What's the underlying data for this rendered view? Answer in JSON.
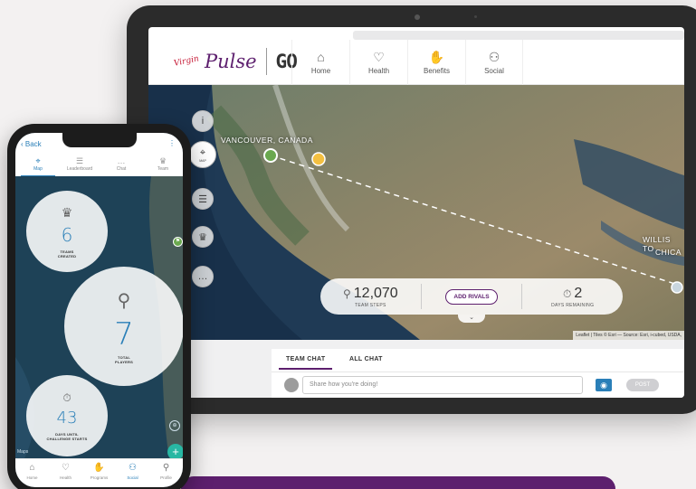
{
  "tablet": {
    "brand": {
      "virgin": "Virgin",
      "pulse": "Pulse",
      "go": "GO"
    },
    "nav": [
      {
        "label": "Home",
        "icon": "home-icon",
        "glyph": "⌂"
      },
      {
        "label": "Health",
        "icon": "heart-icon",
        "glyph": "♡"
      },
      {
        "label": "Benefits",
        "icon": "handshake-icon",
        "glyph": "✋"
      },
      {
        "label": "Social",
        "icon": "people-icon",
        "glyph": "⚇"
      }
    ],
    "map": {
      "cities": {
        "origin": "VANCOUVER, CANADA",
        "dest_line1": "WILLIS TO",
        "dest_line2": "CHICA"
      },
      "side_buttons": [
        {
          "icon": "info-icon",
          "glyph": "i"
        },
        {
          "icon": "location-icon",
          "glyph": "⌖",
          "caption": "MAP"
        },
        {
          "icon": "list-icon",
          "glyph": "☰"
        },
        {
          "icon": "trophy-icon",
          "glyph": "♛"
        },
        {
          "icon": "chat-icon",
          "glyph": "…"
        }
      ],
      "stats": {
        "team_steps_value": "12,070",
        "team_steps_label": "TEAM STEPS",
        "add_rivals": "ADD RIVALS",
        "days_value": "2",
        "days_label": "DAYS REMAINING"
      },
      "attribution": "Leaflet | Tiles © Esri — Source: Esri, i-cubed, USDA,"
    },
    "chat": {
      "tabs": [
        "TEAM CHAT",
        "ALL CHAT"
      ],
      "placeholder": "Share how you're doing!",
      "send": "POST"
    }
  },
  "phone": {
    "back": "Back",
    "tabs": [
      {
        "label": "Map",
        "glyph": "⌖"
      },
      {
        "label": "Leaderboard",
        "glyph": "☰"
      },
      {
        "label": "Chat",
        "glyph": "…"
      },
      {
        "label": "Team",
        "glyph": "♛"
      }
    ],
    "bubbles": {
      "teams": {
        "value": "6",
        "label_line1": "TEAMS",
        "label_line2": "CREATED"
      },
      "players": {
        "value": "7",
        "label_line1": "TOTAL",
        "label_line2": "PLAYERS"
      },
      "days": {
        "value": "43",
        "label_line1": "DAYS UNTIL",
        "label_line2": "CHALLENGE STARTS"
      }
    },
    "maps_label": "Maps",
    "footer": [
      {
        "label": "Home",
        "glyph": "⌂"
      },
      {
        "label": "Health",
        "glyph": "♡"
      },
      {
        "label": "Programs",
        "glyph": "✋"
      },
      {
        "label": "Social",
        "glyph": "⚇"
      },
      {
        "label": "Profile",
        "glyph": "⚲"
      }
    ]
  },
  "colors": {
    "brand_purple": "#5d1f6e",
    "accent_blue": "#2a7fb8",
    "fab_teal": "#28b7a3",
    "background": "#f3f1f1"
  }
}
